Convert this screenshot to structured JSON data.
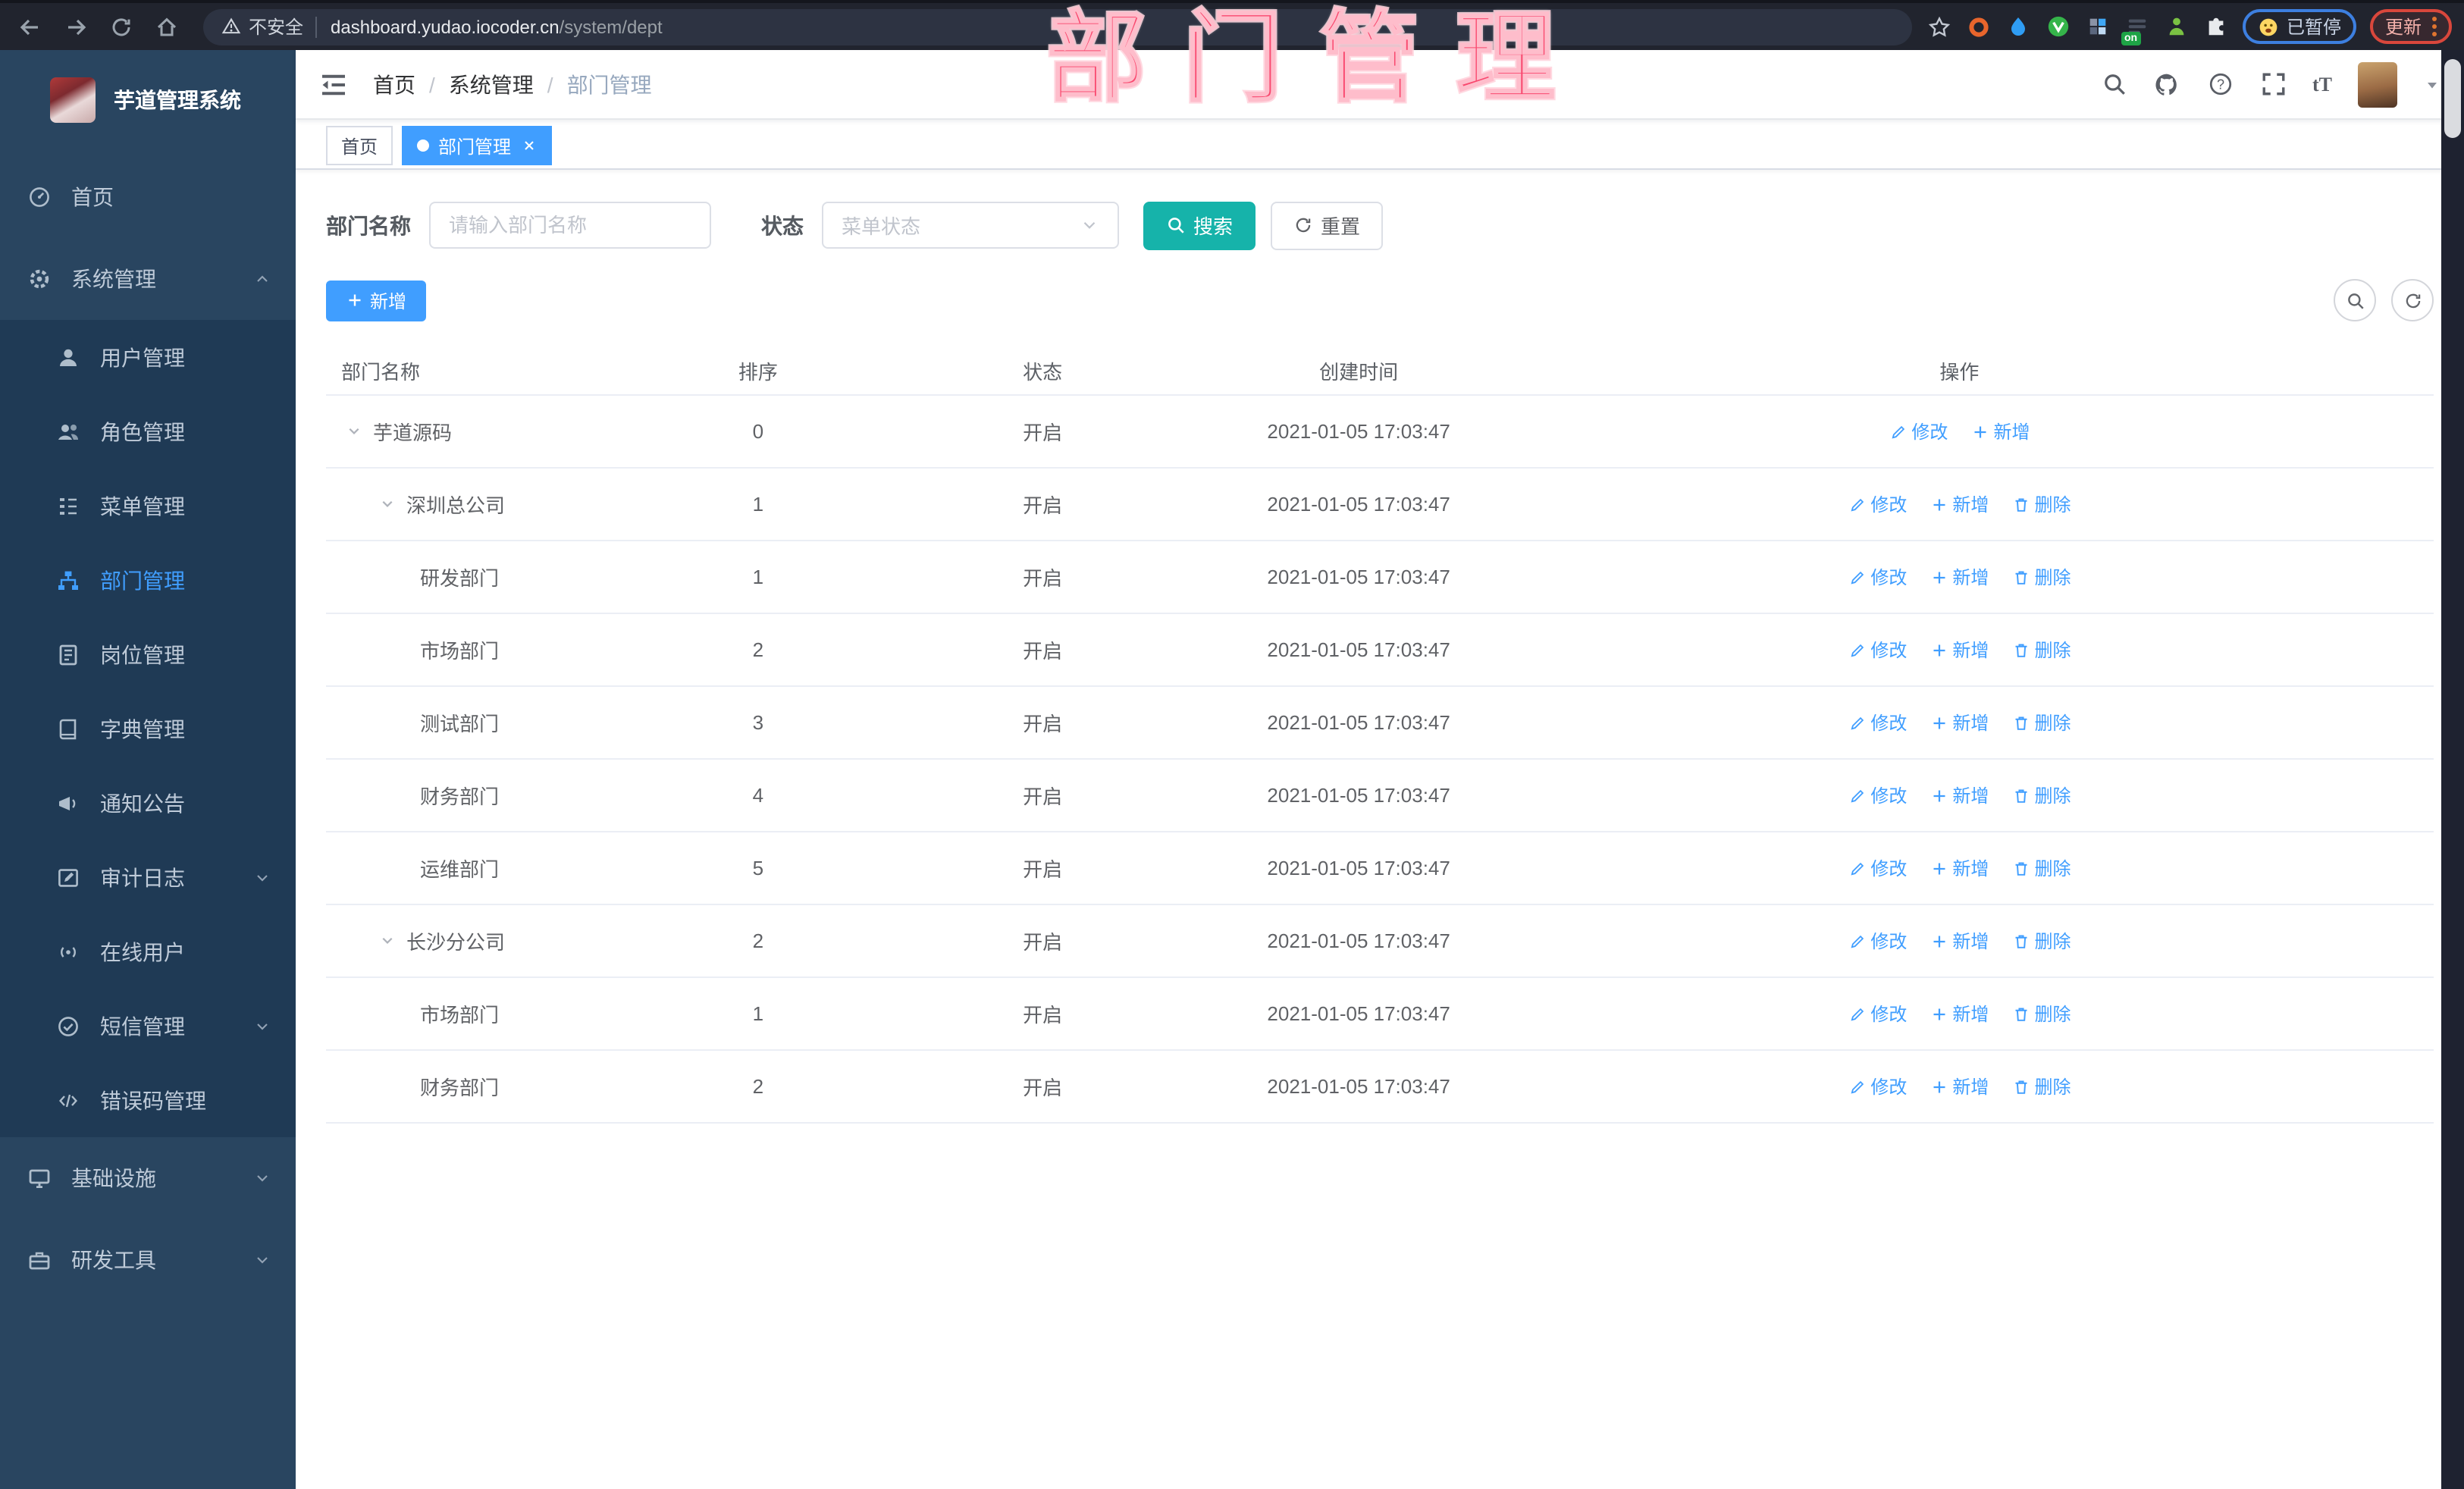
{
  "browser": {
    "security_label": "不安全",
    "url_host": "dashboard.yudao.iocoder.cn",
    "url_path": "/system/dept",
    "paused_badge": "已暂停",
    "update_button": "更新"
  },
  "watermark": "部门管理",
  "colors": {
    "primary": "#409eff",
    "teal": "#16b3aa",
    "sidebar-bg": "#294560",
    "submenu-bg": "#1f3a55",
    "watermark": "#f9486e",
    "chrome-bg": "#21242e"
  },
  "sidebar": {
    "app_title": "芋道管理系统",
    "items": [
      {
        "id": "home",
        "label": "首页",
        "icon": "dashboard",
        "sub": false
      },
      {
        "id": "system-management",
        "label": "系统管理",
        "icon": "gear",
        "sub": false,
        "chevron": "up"
      },
      {
        "id": "user-management",
        "label": "用户管理",
        "icon": "user",
        "sub": true
      },
      {
        "id": "role-management",
        "label": "角色管理",
        "icon": "users",
        "sub": true
      },
      {
        "id": "menu-management",
        "label": "菜单管理",
        "icon": "menu-tree",
        "sub": true
      },
      {
        "id": "dept-management",
        "label": "部门管理",
        "icon": "org-tree",
        "sub": true,
        "active": true
      },
      {
        "id": "post-management",
        "label": "岗位管理",
        "icon": "id-badge",
        "sub": true
      },
      {
        "id": "dict-management",
        "label": "字典管理",
        "icon": "dictionary",
        "sub": true
      },
      {
        "id": "notice-announcement",
        "label": "通知公告",
        "icon": "megaphone",
        "sub": true
      },
      {
        "id": "audit-log",
        "label": "审计日志",
        "icon": "edit-log",
        "sub": true,
        "chevron": "down"
      },
      {
        "id": "online-users",
        "label": "在线用户",
        "icon": "online",
        "sub": true
      },
      {
        "id": "sms-management",
        "label": "短信管理",
        "icon": "sms",
        "sub": true,
        "chevron": "down"
      },
      {
        "id": "error-code-management",
        "label": "错误码管理",
        "icon": "code",
        "sub": true
      },
      {
        "id": "infrastructure",
        "label": "基础设施",
        "icon": "infrastructure",
        "sub": false,
        "chevron": "down"
      },
      {
        "id": "dev-tools",
        "label": "研发工具",
        "icon": "tools",
        "sub": false,
        "chevron": "down"
      }
    ]
  },
  "header": {
    "breadcrumb": [
      "首页",
      "系统管理",
      "部门管理"
    ]
  },
  "tabs": [
    {
      "id": "home",
      "label": "首页",
      "active": false,
      "closable": false
    },
    {
      "id": "dept-management",
      "label": "部门管理",
      "active": true,
      "closable": true
    }
  ],
  "filters": {
    "dept_name_label": "部门名称",
    "dept_name_placeholder": "请输入部门名称",
    "status_label": "状态",
    "status_placeholder": "菜单状态",
    "search_label": "搜索",
    "reset_label": "重置"
  },
  "toolbar": {
    "add_label": "新增"
  },
  "table": {
    "columns": [
      "部门名称",
      "排序",
      "状态",
      "创建时间",
      "操作"
    ],
    "rows": [
      {
        "name": "芋道源码",
        "level": 0,
        "expandable": true,
        "sort": "0",
        "status": "开启",
        "created": "2021-01-05 17:03:47",
        "actions": [
          {
            "icon": "edit",
            "label": "修改"
          },
          {
            "icon": "plus",
            "label": "新增"
          }
        ]
      },
      {
        "name": "深圳总公司",
        "level": 1,
        "expandable": true,
        "sort": "1",
        "status": "开启",
        "created": "2021-01-05 17:03:47",
        "actions": [
          {
            "icon": "edit",
            "label": "修改"
          },
          {
            "icon": "plus",
            "label": "新增"
          },
          {
            "icon": "trash",
            "label": "删除"
          }
        ]
      },
      {
        "name": "研发部门",
        "level": 2,
        "expandable": false,
        "sort": "1",
        "status": "开启",
        "created": "2021-01-05 17:03:47",
        "actions": [
          {
            "icon": "edit",
            "label": "修改"
          },
          {
            "icon": "plus",
            "label": "新增"
          },
          {
            "icon": "trash",
            "label": "删除"
          }
        ]
      },
      {
        "name": "市场部门",
        "level": 2,
        "expandable": false,
        "sort": "2",
        "status": "开启",
        "created": "2021-01-05 17:03:47",
        "actions": [
          {
            "icon": "edit",
            "label": "修改"
          },
          {
            "icon": "plus",
            "label": "新增"
          },
          {
            "icon": "trash",
            "label": "删除"
          }
        ]
      },
      {
        "name": "测试部门",
        "level": 2,
        "expandable": false,
        "sort": "3",
        "status": "开启",
        "created": "2021-01-05 17:03:47",
        "actions": [
          {
            "icon": "edit",
            "label": "修改"
          },
          {
            "icon": "plus",
            "label": "新增"
          },
          {
            "icon": "trash",
            "label": "删除"
          }
        ]
      },
      {
        "name": "财务部门",
        "level": 2,
        "expandable": false,
        "sort": "4",
        "status": "开启",
        "created": "2021-01-05 17:03:47",
        "actions": [
          {
            "icon": "edit",
            "label": "修改"
          },
          {
            "icon": "plus",
            "label": "新增"
          },
          {
            "icon": "trash",
            "label": "删除"
          }
        ]
      },
      {
        "name": "运维部门",
        "level": 2,
        "expandable": false,
        "sort": "5",
        "status": "开启",
        "created": "2021-01-05 17:03:47",
        "actions": [
          {
            "icon": "edit",
            "label": "修改"
          },
          {
            "icon": "plus",
            "label": "新增"
          },
          {
            "icon": "trash",
            "label": "删除"
          }
        ]
      },
      {
        "name": "长沙分公司",
        "level": 1,
        "expandable": true,
        "sort": "2",
        "status": "开启",
        "created": "2021-01-05 17:03:47",
        "actions": [
          {
            "icon": "edit",
            "label": "修改"
          },
          {
            "icon": "plus",
            "label": "新增"
          },
          {
            "icon": "trash",
            "label": "删除"
          }
        ]
      },
      {
        "name": "市场部门",
        "level": 2,
        "expandable": false,
        "sort": "1",
        "status": "开启",
        "created": "2021-01-05 17:03:47",
        "actions": [
          {
            "icon": "edit",
            "label": "修改"
          },
          {
            "icon": "plus",
            "label": "新增"
          },
          {
            "icon": "trash",
            "label": "删除"
          }
        ]
      },
      {
        "name": "财务部门",
        "level": 2,
        "expandable": false,
        "sort": "2",
        "status": "开启",
        "created": "2021-01-05 17:03:47",
        "actions": [
          {
            "icon": "edit",
            "label": "修改"
          },
          {
            "icon": "plus",
            "label": "新增"
          },
          {
            "icon": "trash",
            "label": "删除"
          }
        ]
      }
    ]
  }
}
